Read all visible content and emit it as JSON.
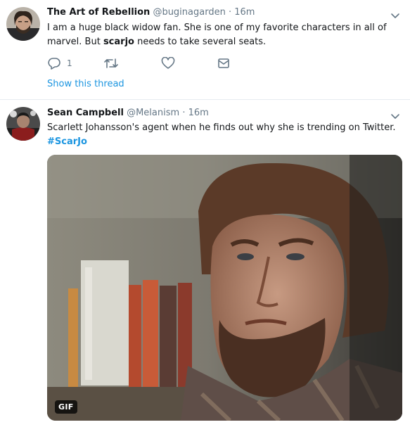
{
  "tweets": [
    {
      "display_name": "The Art of Rebellion",
      "handle": "@buginagarden",
      "separator": "·",
      "time": "16m",
      "text_parts": [
        "I am a huge black widow fan. She is one of my favorite characters in all of marvel. But ",
        "scarjo",
        " needs to take several seats."
      ],
      "reply_count": "1",
      "show_thread": "Show this thread"
    },
    {
      "display_name": "Sean Campbell",
      "handle": "@Melanism",
      "separator": "·",
      "time": "16m",
      "text": "Scarlett Johansson's agent when he finds out why she is trending on Twitter.",
      "hashtag": "#ScarJo",
      "media_badge": "GIF"
    }
  ],
  "icons": {
    "reply": "reply-icon",
    "retweet": "retweet-icon",
    "like": "heart-icon",
    "dm": "envelope-icon",
    "caret": "chevron-down-icon"
  },
  "colors": {
    "link": "#1b95e0",
    "secondary_text": "#657786",
    "primary_text": "#14171a",
    "divider": "#e6ecf0"
  }
}
